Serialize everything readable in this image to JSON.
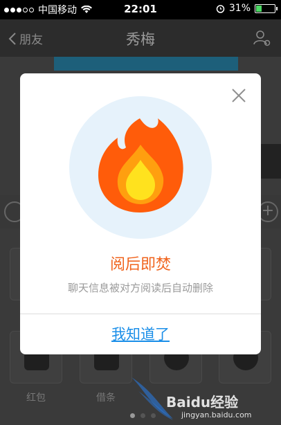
{
  "status_bar": {
    "carrier": "中国移动",
    "time": "22:01",
    "battery_percent": "31%",
    "battery_level": 0.31
  },
  "nav": {
    "back_label": "朋友",
    "title": "秀梅"
  },
  "background": {
    "tiles": [
      {
        "label": "红包",
        "icon": "red-packet-icon"
      },
      {
        "label": "借条",
        "icon": "iou-icon"
      },
      {
        "label": "",
        "icon": "location-icon"
      },
      {
        "label": "",
        "icon": "burn-icon"
      }
    ]
  },
  "modal": {
    "title": "阅后即焚",
    "description": "聊天信息被对方阅读后自动删除",
    "confirm_label": "我知道了",
    "icon": "flame-icon"
  },
  "watermark": {
    "text": "Baidu经验",
    "url": "jingyan.baidu.com"
  },
  "colors": {
    "accent_orange": "#f0641e",
    "link_blue": "#1a8ee8",
    "flame_circle": "#e6f2fb"
  }
}
